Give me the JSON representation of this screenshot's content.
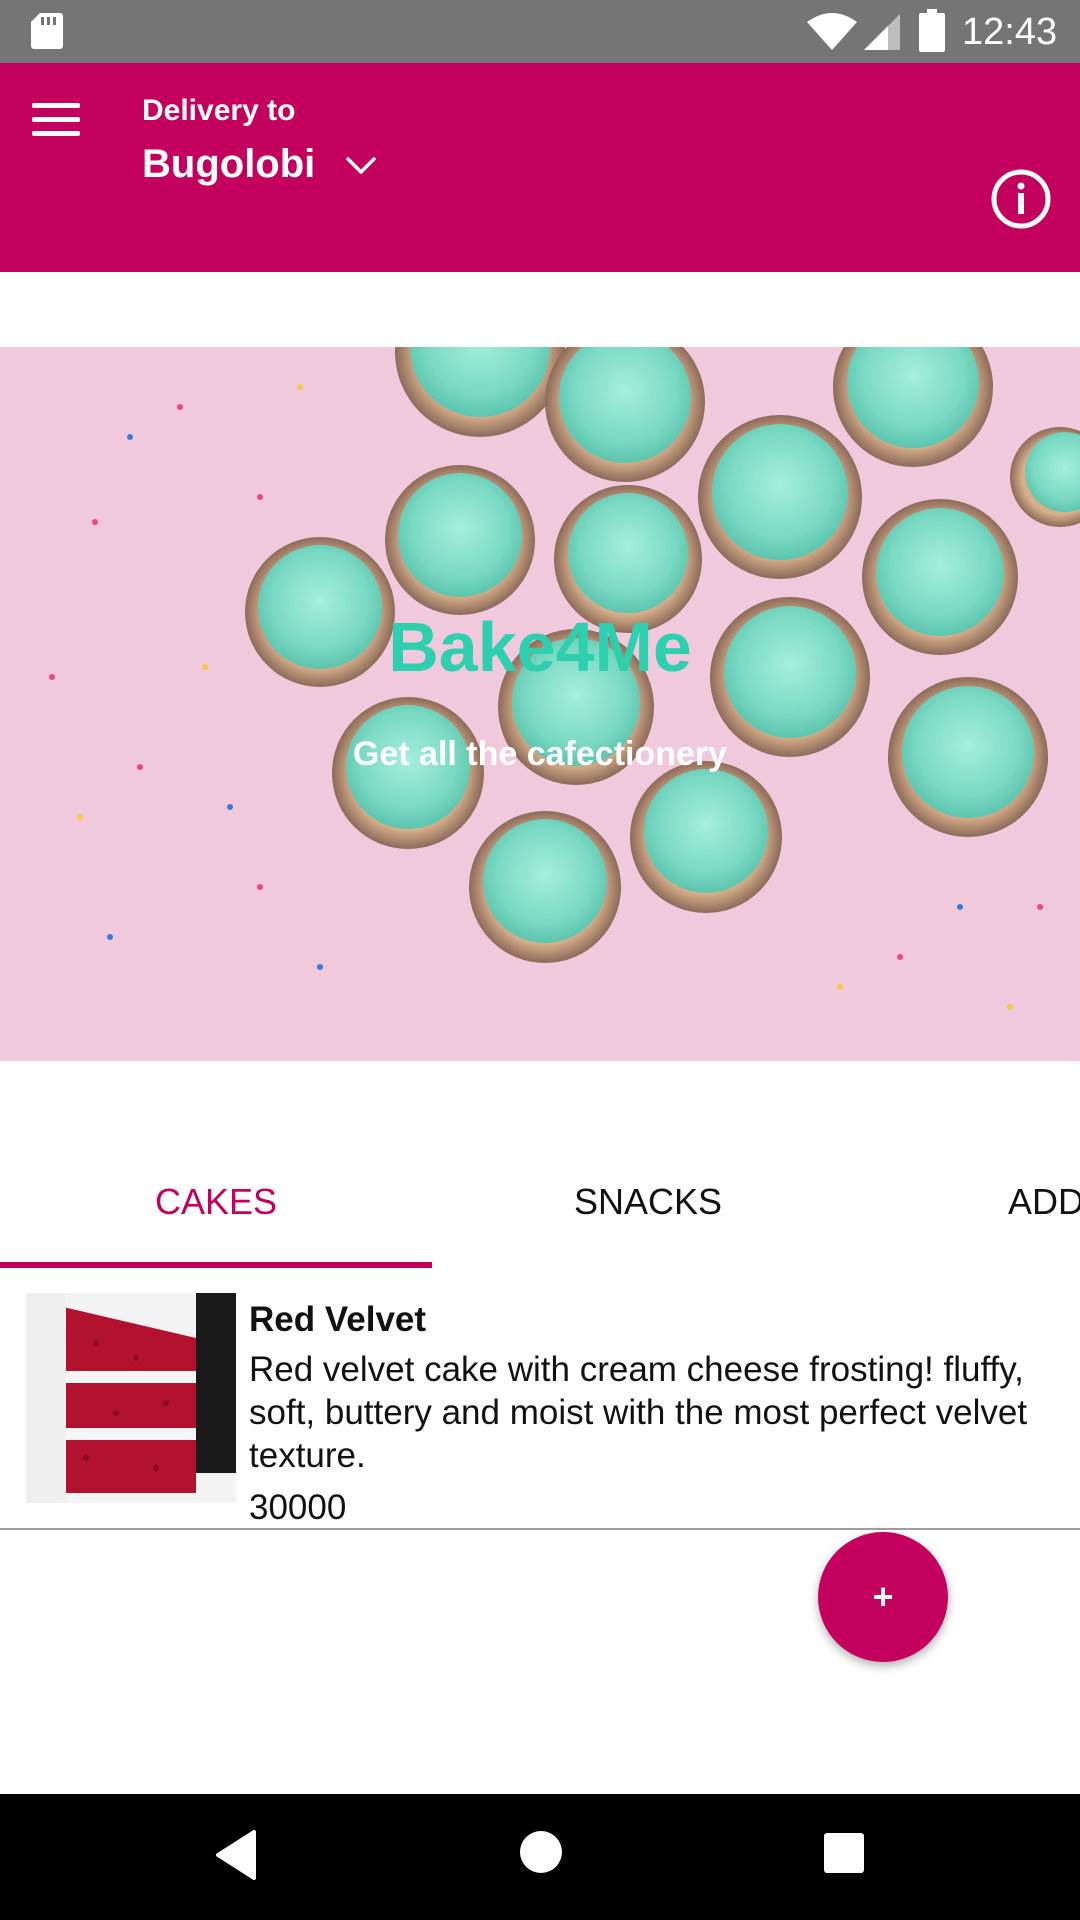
{
  "status_bar": {
    "time": "12:43",
    "icons": [
      "sd-card-icon",
      "wifi-icon",
      "cell-signal-icon",
      "battery-icon"
    ]
  },
  "app_bar": {
    "delivery_label": "Delivery to",
    "location": "Bugolobi",
    "icons": [
      "menu-icon",
      "chevron-down-icon",
      "info-icon"
    ],
    "color": "#c4005f"
  },
  "hero": {
    "title": "Bake4Me",
    "subtitle": "Get all the cafectionery",
    "title_color": "#2ecfae",
    "background_color": "#f0c9dc"
  },
  "tabs": [
    {
      "label": "CAKES",
      "active": true
    },
    {
      "label": "SNACKS",
      "active": false
    },
    {
      "label": "ADD",
      "active": false
    }
  ],
  "products": [
    {
      "name": "Red Velvet",
      "description": "Red velvet cake with cream cheese frosting! fluffy, soft, buttery and moist with the most perfect velvet texture.",
      "price": "30000"
    }
  ],
  "fab": {
    "label": "+"
  },
  "nav_bar": {
    "icons": [
      "back-icon",
      "home-icon",
      "recents-icon"
    ]
  }
}
